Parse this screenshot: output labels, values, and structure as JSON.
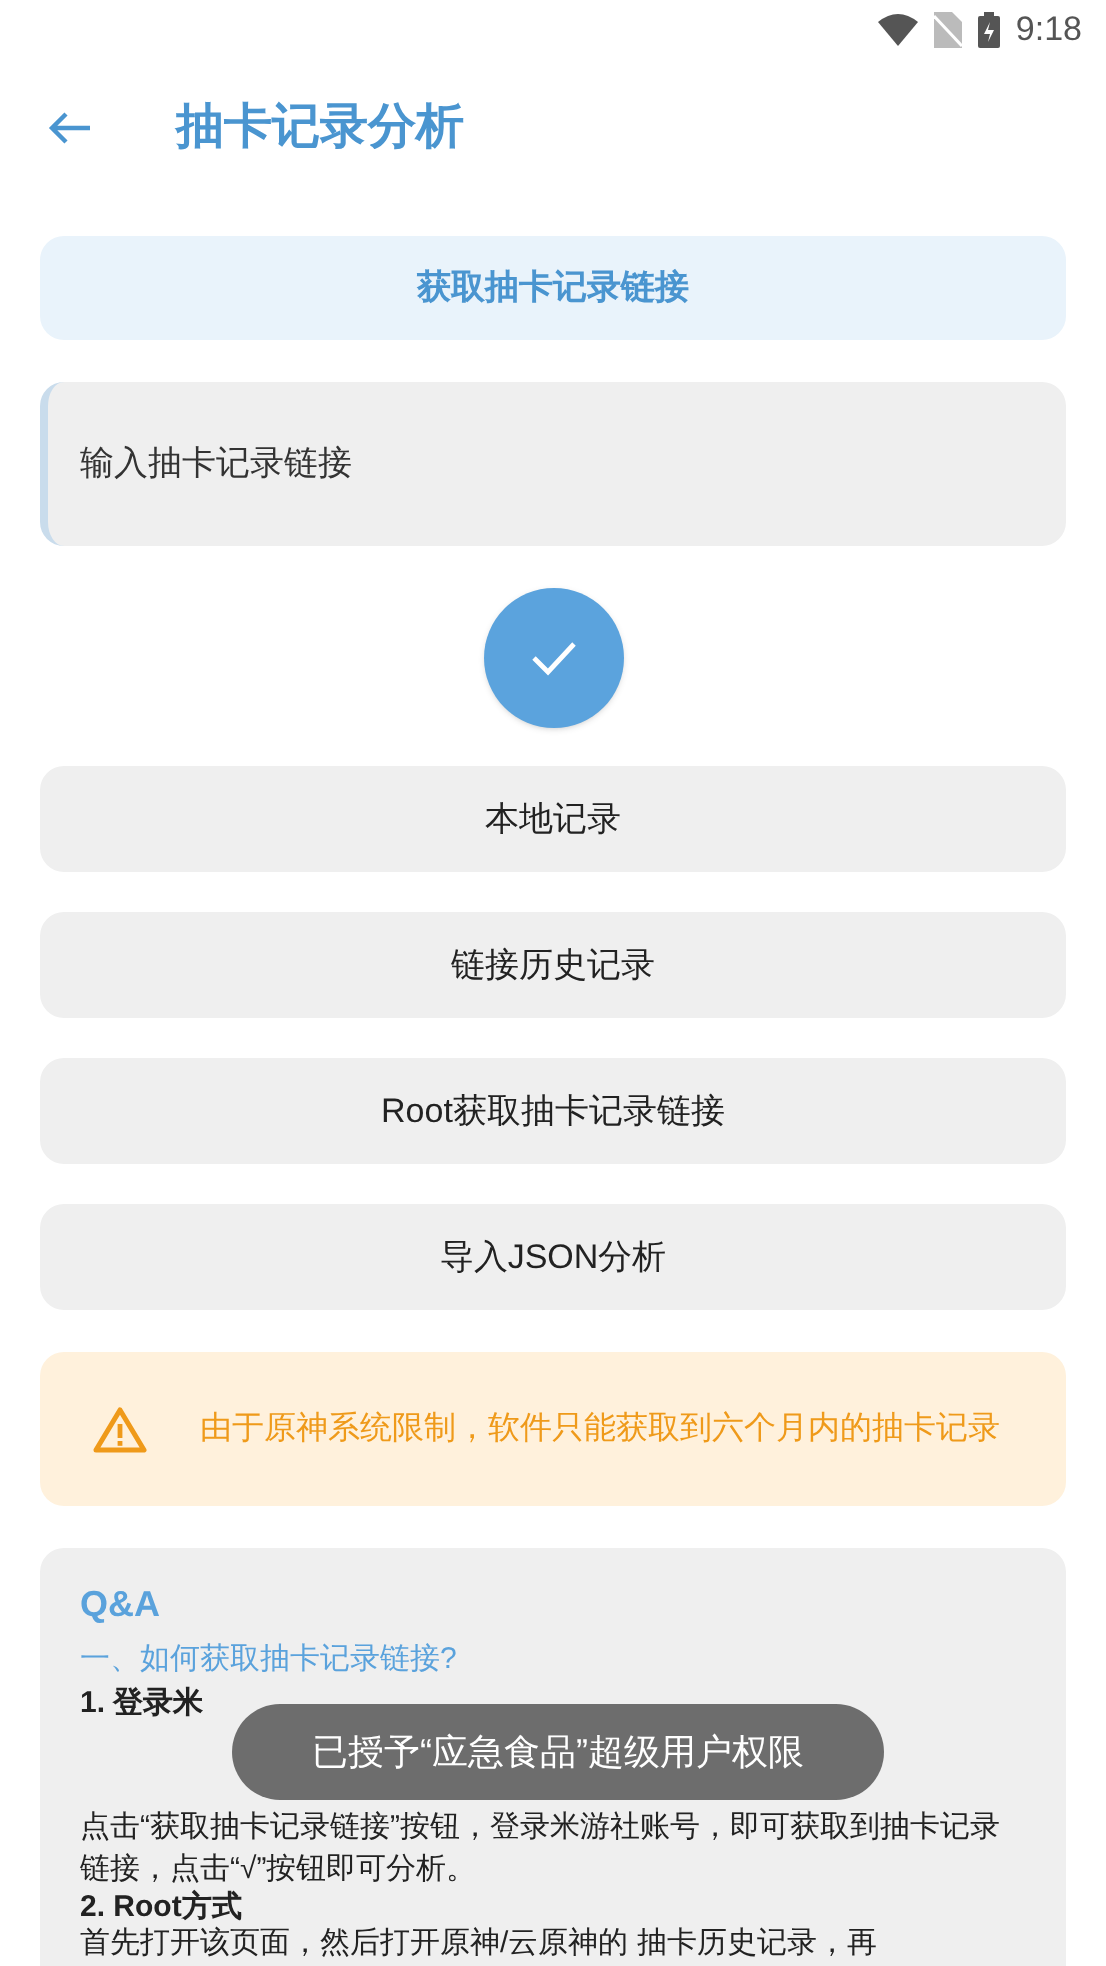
{
  "status_bar": {
    "time": "9:18"
  },
  "header": {
    "title": "抽卡记录分析"
  },
  "fetch_button": "获取抽卡记录链接",
  "link_input": {
    "placeholder": "输入抽卡记录链接"
  },
  "action_buttons": [
    "本地记录",
    "链接历史记录",
    "Root获取抽卡记录链接",
    "导入JSON分析"
  ],
  "warning": "由于原神系统限制，软件只能获取到六个月内的抽卡记录",
  "qa": {
    "title": "Q&A",
    "question": "一、如何获取抽卡记录链接?",
    "items": [
      {
        "heading": "1. 登录米",
        "text": "点击“获取抽卡记录链接”按钮，登录米游社账号，即可获取到抽卡记录链接，点击“√”按钮即可分析。"
      },
      {
        "heading": "2. Root方式",
        "text": "首先打开该页面，然后打开原神/云原神的 抽卡历史记录，再"
      }
    ]
  },
  "toast": "已授予“应急食品”超级用户权限"
}
